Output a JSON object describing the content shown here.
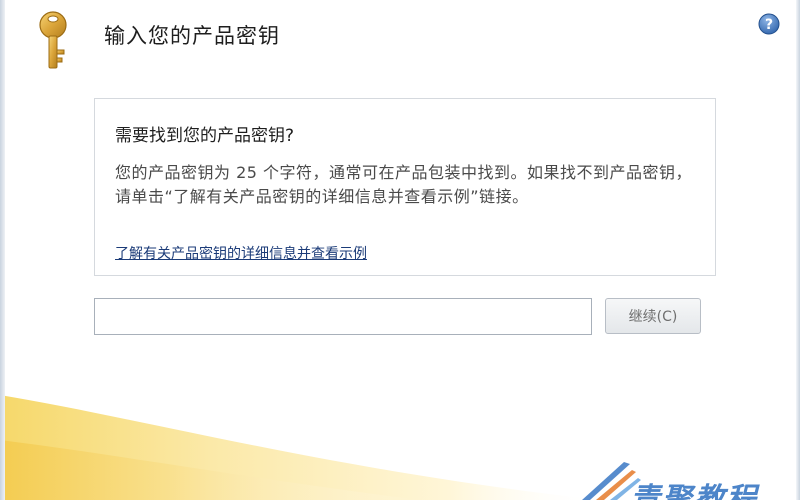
{
  "dialog": {
    "title": "输入您的产品密钥",
    "help_icon": "help-question-icon",
    "key_icon": "key-icon"
  },
  "info": {
    "heading": "需要找到您的产品密钥?",
    "text": "您的产品密钥为 25 个字符，通常可在产品包装中找到。如果找不到产品密钥，请单击“了解有关产品密钥的详细信息并查看示例”链接。",
    "link": "了解有关产品密钥的详细信息并查看示例"
  },
  "key_field": {
    "value": "",
    "placeholder": ""
  },
  "continue_button": {
    "label": "继续(C)"
  },
  "watermark": {
    "text": "青聚教程"
  },
  "colors": {
    "accent_gold": "#d9a528",
    "link_blue": "#1b3b78",
    "help_blue": "#2f6fb8"
  }
}
